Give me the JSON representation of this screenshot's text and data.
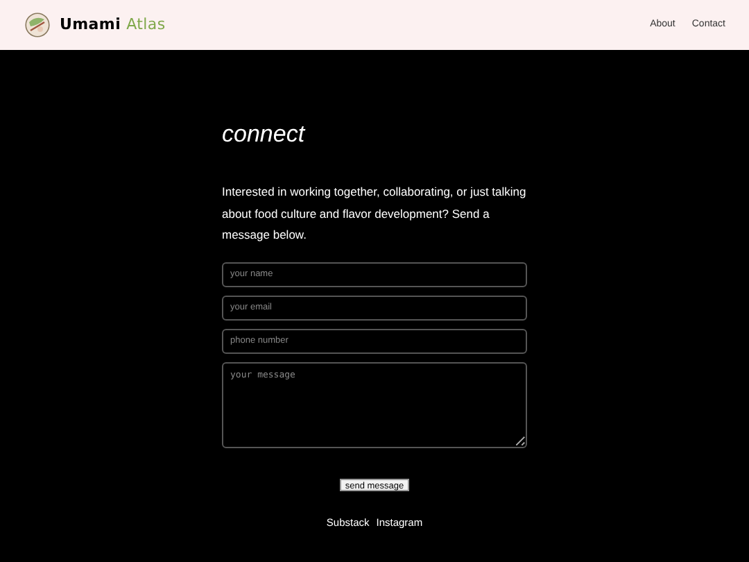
{
  "header": {
    "brand": {
      "name": "Umami",
      "accent": "Atlas"
    },
    "nav": [
      {
        "label": "About"
      },
      {
        "label": "Contact"
      }
    ]
  },
  "title": "connect",
  "intro": "Interested in working together, collaborating, or just talking about food culture and flavor development? Send a message below.",
  "form": {
    "fields": [
      {
        "kind": "input",
        "placeholder": "your name"
      },
      {
        "kind": "input",
        "placeholder": "your email"
      },
      {
        "kind": "input",
        "placeholder": "phone number"
      },
      {
        "kind": "textarea",
        "placeholder": "your message"
      }
    ],
    "submit": "send message"
  },
  "links": [
    {
      "label": "Substack"
    },
    {
      "label": "Instagram"
    }
  ]
}
